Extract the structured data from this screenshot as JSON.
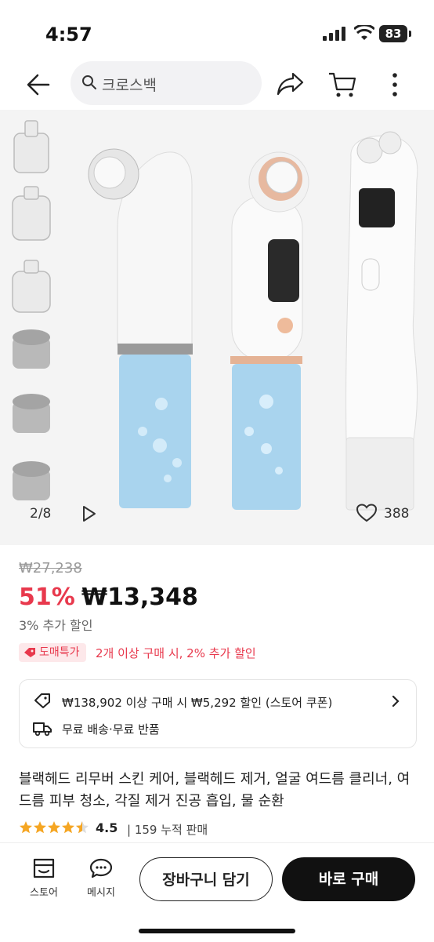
{
  "status": {
    "time": "4:57",
    "battery": "83"
  },
  "nav": {
    "search_text": "크로스백"
  },
  "gallery": {
    "counter": "2/8",
    "likes": "388"
  },
  "pricing": {
    "original": "₩27,238",
    "discount": "51%",
    "price": "₩13,348",
    "extra_discount": "3% 추가 할인"
  },
  "promo": {
    "badge": "도매특가",
    "text": "2개 이상 구매 시, 2% 추가 할인"
  },
  "benefits": {
    "coupon": "₩138,902 이상 구매 시 ₩5,292 할인 (스토어 쿠폰)",
    "shipping": "무료 배송·무료 반품"
  },
  "product": {
    "title": "블랙헤드 리무버 스킨 케어, 블랙헤드 제거, 얼굴 여드름 클리너, 여드름 피부 청소, 각질 제거 진공 흡입, 물 순환",
    "rating": "4.5",
    "rating_value": 4.5,
    "sold": "| 159 누적 판매"
  },
  "bottom": {
    "store_label": "스토어",
    "message_label": "메시지",
    "add_to_cart": "장바구니 담기",
    "buy_now": "바로 구매"
  },
  "colors": {
    "accent": "#e8394d",
    "dark": "#111111",
    "badge_bg": "#fde8ea",
    "star": "#f5a623"
  },
  "icons": [
    "back-arrow-icon",
    "search-icon",
    "share-icon",
    "cart-icon",
    "more-icon",
    "play-icon",
    "heart-icon",
    "tag-icon",
    "coupon-icon",
    "truck-icon",
    "chevron-right-icon",
    "store-icon",
    "message-icon"
  ]
}
